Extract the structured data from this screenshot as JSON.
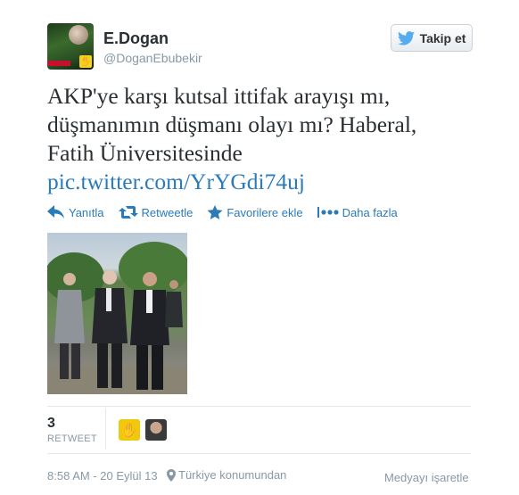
{
  "user": {
    "display_name": "E.Dogan",
    "username": "@DoganEbubekir"
  },
  "follow_button": {
    "label": "Takip et",
    "icon": "twitter-bird-icon"
  },
  "tweet": {
    "text_lines": [
      "AKP'ye karşı kutsal ittifak arayışı mı,",
      "düşmanımın düşmanı olayı mı? Haberal,",
      "Fatih Üniversitesinde"
    ],
    "link": "pic.twitter.com/YrYGdi74uj"
  },
  "actions": {
    "reply": "Yanıtla",
    "retweet": "Retweetle",
    "favorite": "Favorilere ekle",
    "more": "Daha fazla"
  },
  "stats": {
    "retweet_count": "3",
    "retweet_label": "RETWEET"
  },
  "footer": {
    "timestamp": "8:58 AM - 20 Eylül 13",
    "location": "Türkiye konumundan",
    "flag_media": "Medyayı işaretle"
  },
  "colors": {
    "link": "#2b7bb9",
    "muted": "#8899a6",
    "text": "#292f33",
    "twitter_blue": "#55acee"
  }
}
